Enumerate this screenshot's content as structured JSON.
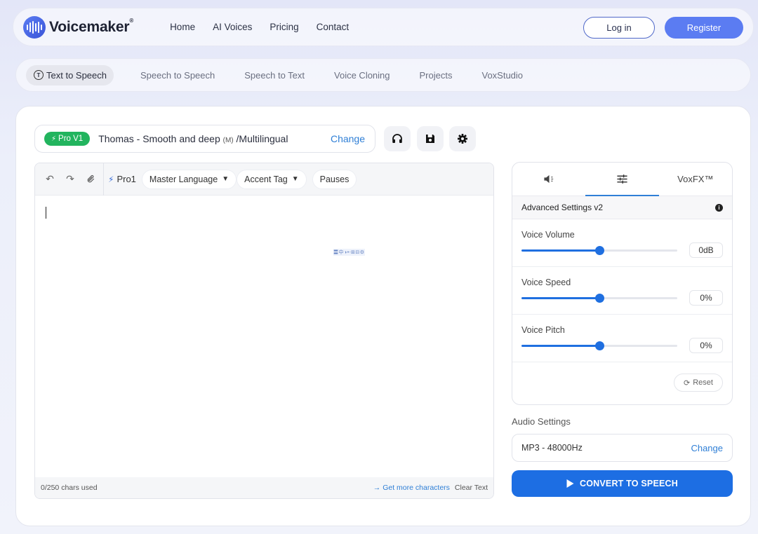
{
  "brand": {
    "name": "Voicemaker",
    "reg": "®"
  },
  "nav": {
    "items": [
      "Home",
      "AI Voices",
      "Pricing",
      "Contact"
    ]
  },
  "auth": {
    "login": "Log in",
    "register": "Register"
  },
  "tabs": {
    "items": [
      "Text to Speech",
      "Speech to Speech",
      "Speech to Text",
      "Voice Cloning",
      "Projects",
      "VoxStudio"
    ],
    "active": "Text to Speech",
    "active_icon": "T"
  },
  "voice": {
    "badge": "Pro V1",
    "name": "Thomas - Smooth and deep",
    "gender": "(M)",
    "suffix": "/Multilingual",
    "change": "Change"
  },
  "toolbar": {
    "pro_label": "Pro1",
    "master_language": "Master Language",
    "accent_tag": "Accent Tag",
    "pauses": "Pauses"
  },
  "editor": {
    "text": "",
    "chars_used": "0/250 chars used",
    "get_more": "→ Get more characters",
    "clear": "Clear Text"
  },
  "panel": {
    "tab3": "VoxFX™",
    "adv_title": "Advanced Settings v2",
    "sliders": [
      {
        "label": "Voice Volume",
        "value": "0dB",
        "level": 0.5
      },
      {
        "label": "Voice Speed",
        "value": "0%",
        "level": 0.5
      },
      {
        "label": "Voice Pitch",
        "value": "0%",
        "level": 0.5
      }
    ],
    "reset": "Reset"
  },
  "audio": {
    "label": "Audio Settings",
    "format": "MP3 - 48000Hz",
    "change": "Change"
  },
  "convert": {
    "label": "CONVERT TO SPEECH"
  },
  "colors": {
    "accent": "#1d6ee3",
    "brand": "#5b7cf2",
    "badge": "#22b45e",
    "link": "#2f7fd6"
  }
}
